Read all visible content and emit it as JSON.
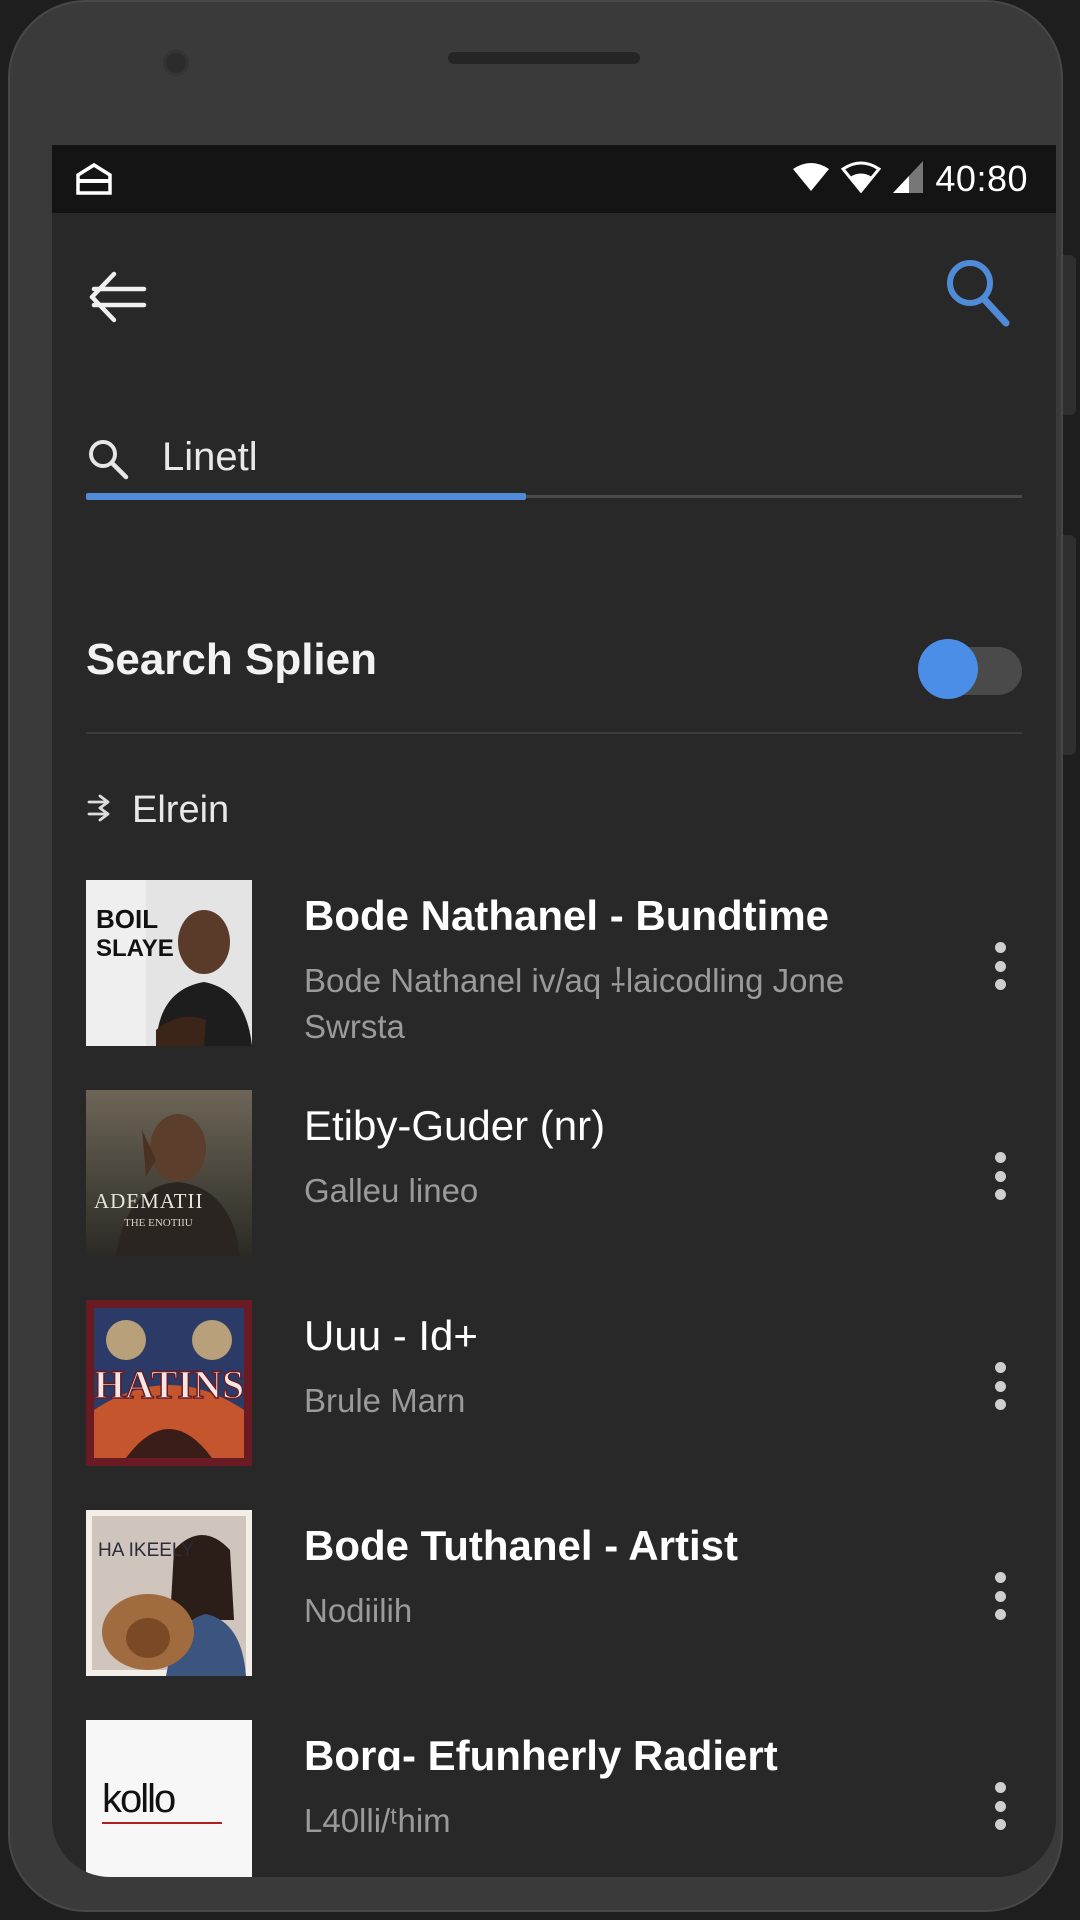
{
  "status_bar": {
    "time": "40:80",
    "left_icon": "home-icon",
    "right_icons": [
      "wifi-icon",
      "wifi-alt-icon",
      "signal-icon"
    ]
  },
  "toolbar": {
    "back_icon": "back-arrow-icon",
    "search_icon": "search-icon",
    "accent_color": "#4f8bd6"
  },
  "search": {
    "value": "Linetl",
    "progress": 0.47
  },
  "toggle_row": {
    "label": "Search Splien",
    "on": true
  },
  "section": {
    "title": "Elrein",
    "icon": "arrow-turn-icon"
  },
  "results": [
    {
      "title": "Bode Nathanel - Bundtime",
      "subtitle": "Bode Nathanel iv/aq ⸸laicodling Jone Swrsta",
      "cover_text": [
        "BOIL",
        "SLAYE"
      ]
    },
    {
      "title": "Etiby-Guder (nr)",
      "subtitle": "Galleu lineo",
      "cover_text": [
        "ADEMATII",
        "THE ENOTIIU"
      ]
    },
    {
      "title": "Uuu - Id+",
      "subtitle": "Brule Marn",
      "cover_text": [
        "HATINS"
      ]
    },
    {
      "title": "Bode Tuthanel - Artist",
      "subtitle": "Nodiilih",
      "cover_text": [
        "HA IKEELY"
      ]
    },
    {
      "title": "Borɑ- Efunherly Radiert",
      "subtitle": "L40lli/ᵗhim",
      "cover_text": [
        "kollo"
      ]
    }
  ]
}
